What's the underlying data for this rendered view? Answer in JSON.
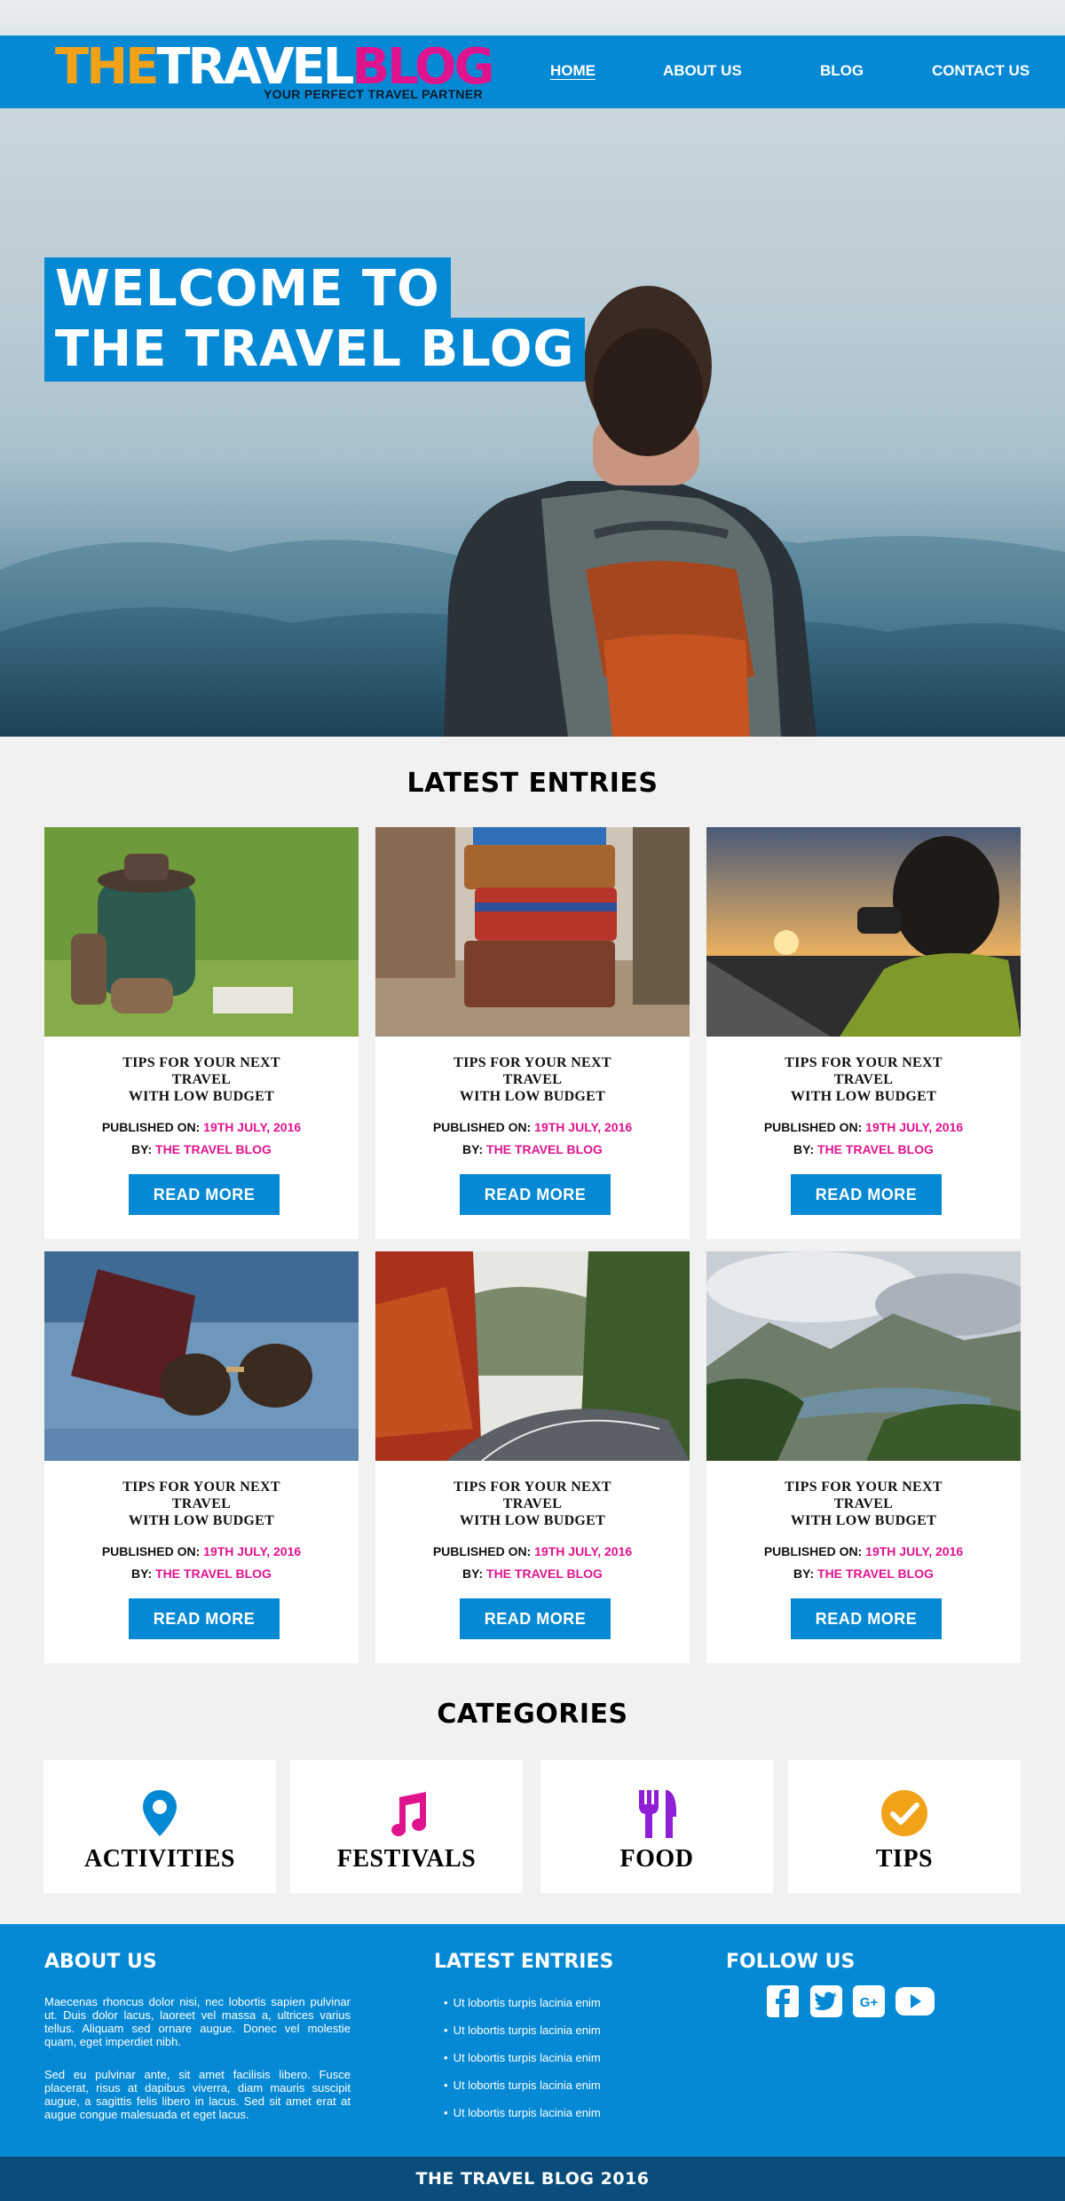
{
  "brand": {
    "logo_part1": "THE",
    "logo_part2": "TRAVEL",
    "logo_part3": "BLOG",
    "tagline": "YOUR PERFECT TRAVEL PARTNER"
  },
  "nav": {
    "items": [
      {
        "label": "HOME",
        "active": true
      },
      {
        "label": "ABOUT US"
      },
      {
        "label": "BLOG"
      },
      {
        "label": "CONTACT US"
      }
    ]
  },
  "hero": {
    "line1": "WELCOME TO",
    "line2": "THE TRAVEL BLOG"
  },
  "latest": {
    "title": "LATEST ENTRIES",
    "cards": [
      {
        "title_l1": "TIPS FOR YOUR NEXT",
        "title_l2": "TRAVEL",
        "title_l3": "WITH LOW BUDGET",
        "published_label": "PUBLISHED ON:",
        "published_date": "19TH JULY, 2016",
        "by_label": "BY:",
        "author": "THE TRAVEL BLOG",
        "button": "READ MORE"
      },
      {
        "title_l1": "TIPS FOR YOUR NEXT",
        "title_l2": "TRAVEL",
        "title_l3": "WITH LOW BUDGET",
        "published_label": "PUBLISHED ON:",
        "published_date": "19TH JULY, 2016",
        "by_label": "BY:",
        "author": "THE TRAVEL BLOG",
        "button": "READ MORE"
      },
      {
        "title_l1": "TIPS FOR YOUR NEXT",
        "title_l2": "TRAVEL",
        "title_l3": "WITH LOW BUDGET",
        "published_label": "PUBLISHED ON:",
        "published_date": "19TH JULY, 2016",
        "by_label": "BY:",
        "author": "THE TRAVEL BLOG",
        "button": "READ MORE"
      },
      {
        "title_l1": "TIPS FOR YOUR NEXT",
        "title_l2": "TRAVEL",
        "title_l3": "WITH LOW BUDGET",
        "published_label": "PUBLISHED ON:",
        "published_date": "19TH JULY, 2016",
        "by_label": "BY:",
        "author": "THE TRAVEL BLOG",
        "button": "READ MORE"
      },
      {
        "title_l1": "TIPS FOR YOUR NEXT",
        "title_l2": "TRAVEL",
        "title_l3": "WITH LOW BUDGET",
        "published_label": "PUBLISHED ON:",
        "published_date": "19TH JULY, 2016",
        "by_label": "BY:",
        "author": "THE TRAVEL BLOG",
        "button": "READ MORE"
      },
      {
        "title_l1": "TIPS FOR YOUR NEXT",
        "title_l2": "TRAVEL",
        "title_l3": "WITH LOW BUDGET",
        "published_label": "PUBLISHED ON:",
        "published_date": "19TH JULY, 2016",
        "by_label": "BY:",
        "author": "THE TRAVEL BLOG",
        "button": "READ MORE"
      }
    ]
  },
  "categories": {
    "title": "CATEGORIES",
    "items": [
      {
        "label": "ACTIVITIES",
        "icon": "map-pin-icon",
        "color": "#0589d4"
      },
      {
        "label": "FESTIVALS",
        "icon": "music-note-icon",
        "color": "#e0138f"
      },
      {
        "label": "FOOD",
        "icon": "fork-knife-icon",
        "color": "#8e1fd6"
      },
      {
        "label": "TIPS",
        "icon": "check-circle-icon",
        "color": "#f2a219"
      }
    ]
  },
  "footer": {
    "about_title": "ABOUT US",
    "about_p1": "Maecenas rhoncus dolor nisi, nec lobortis sapien pulvinar ut. Duis dolor lacus, laoreet vel massa a, ultrices varius tellus. Aliquam sed ornare augue. Donec vel molestie quam, eget imperdiet nibh.",
    "about_p2": "Sed eu pulvinar ante, sit amet facilisis libero. Fusce placerat, risus at dapibus viverra, diam mauris suscipit augue, a sagittis felis libero in lacus. Sed sit amet erat at augue congue malesuada et eget lacus.",
    "entries_title": "LATEST ENTRIES",
    "entries": [
      "Ut lobortis turpis lacinia enim",
      "Ut lobortis turpis lacinia enim",
      "Ut lobortis turpis lacinia enim",
      "Ut lobortis turpis lacinia enim",
      "Ut lobortis turpis lacinia enim"
    ],
    "follow_title": "FOLLOW US",
    "social": [
      "facebook-icon",
      "twitter-icon",
      "google-plus-icon",
      "youtube-icon"
    ],
    "copyright": "THE TRAVEL BLOG 2016"
  },
  "colors": {
    "accent": "#0589d4",
    "highlight": "#e0138f",
    "logo_orange": "#f2a219",
    "footer_bar": "#0a4d7a"
  }
}
